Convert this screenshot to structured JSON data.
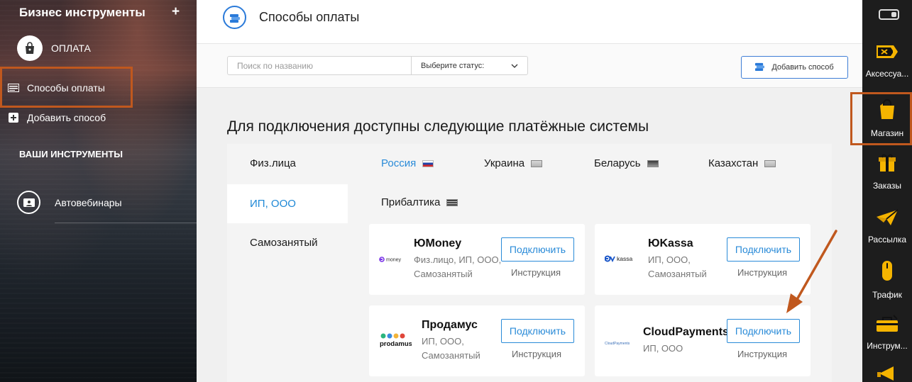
{
  "sidebar": {
    "title": "Бизнес инструменты",
    "plus": "+",
    "oplata_label": "ОПЛАТА",
    "items": [
      {
        "label": "Способы оплаты"
      },
      {
        "label": "Добавить способ"
      }
    ],
    "section_label": "ВАШИ ИНСТРУМЕНТЫ",
    "autowebinars_label": "Автовебинары"
  },
  "header": {
    "title": "Способы оплаты"
  },
  "toolbar": {
    "search_placeholder": "Поиск по названию",
    "status_select": "Выберите статус:",
    "add_button": "Добавить способ"
  },
  "section_title": "Для подключения доступны следующие платёжные системы",
  "left_tabs": [
    {
      "label": "Физ.лица",
      "active": false
    },
    {
      "label": "ИП, ООО",
      "active": true
    },
    {
      "label": "Самозанятый",
      "active": false
    }
  ],
  "country_tabs": [
    {
      "label": "Россия",
      "active": true
    },
    {
      "label": "Украина",
      "active": false
    },
    {
      "label": "Беларусь",
      "active": false
    },
    {
      "label": "Казахстан",
      "active": false
    },
    {
      "label": "Прибалтика",
      "active": false
    }
  ],
  "cards": [
    {
      "name": "ЮMoney",
      "logo_text": "money",
      "desc": [
        "Физ.лицо, ИП, ООО,",
        "Самозанятый"
      ],
      "connect": "Подключить",
      "instruction": "Инструкция"
    },
    {
      "name": "ЮKassa",
      "logo_text": "kassa",
      "desc": [
        "ИП, ООО,",
        "Самозанятый"
      ],
      "connect": "Подключить",
      "instruction": "Инструкция"
    },
    {
      "name": "Продамус",
      "logo_text": "prodamus",
      "desc": [
        "ИП, ООО,",
        "Самозанятый"
      ],
      "connect": "Подключить",
      "instruction": "Инструкция"
    },
    {
      "name": "CloudPayments",
      "logo_text": "CloudPayments",
      "desc": [
        "ИП, ООО"
      ],
      "connect": "Подключить",
      "instruction": "Инструкция"
    }
  ],
  "right_bar": [
    {
      "label": "Аксессуа...",
      "icon": "accessories-icon"
    },
    {
      "label": "Магазин",
      "icon": "shopping-bag-icon"
    },
    {
      "label": "Заказы",
      "icon": "gift-box-icon"
    },
    {
      "label": "Рассылка",
      "icon": "paper-plane-icon"
    },
    {
      "label": "Трафик",
      "icon": "mouse-icon"
    },
    {
      "label": "Инструм...",
      "icon": "toolbox-icon"
    }
  ],
  "colors": {
    "accent_blue": "#2a8bd8",
    "highlight_orange": "#c0581e",
    "right_bar_bg": "#1d1d1d"
  }
}
